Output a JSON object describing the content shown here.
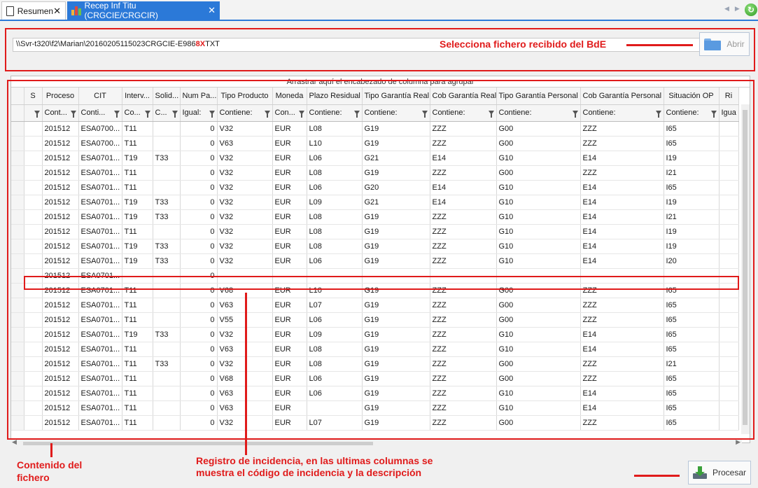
{
  "tabs": [
    {
      "label": "Resumen",
      "close": "✕"
    },
    {
      "label": "Recep Inf Titu (CRGCIE/CRGCIR)",
      "close": "✕"
    }
  ],
  "file": {
    "path_prefix": "\\\\Svr-t320\\f2\\Marian\\20160205115023CRGCIE-E986",
    "path_marked": "8X",
    "path_suffix": "TXT",
    "open_button": "Abrir"
  },
  "annotations": {
    "select_file": "Selecciona fichero recibido del BdE",
    "content": "Contenido del\nfichero",
    "incident": "Registro de incidencia, en las ultimas columnas se\nmuestra el código de incidencia y la descripción"
  },
  "grid": {
    "group_hint": "Arrastrar aquí el encabezado de columna para agrupar",
    "columns": [
      "",
      "S",
      "Proceso",
      "CIT",
      "Interv...",
      "Solid...",
      "Num Pa...",
      "Tipo Producto",
      "Moneda",
      "Plazo Residual",
      "Tipo Garantía Real",
      "Cob Garantía Real",
      "Tipo Garantía Personal",
      "Cob Garantía Personal",
      "Situación OP",
      "Ri"
    ],
    "filters": [
      "",
      "",
      "Cont...",
      "Conti...",
      "Co...",
      "C...",
      "Igual:",
      "Contiene:",
      "Con...",
      "Contiene:",
      "Contiene:",
      "Contiene:",
      "Contiene:",
      "Contiene:",
      "Contiene:",
      "Igua"
    ],
    "rows": [
      [
        "201512",
        "ESA0700...",
        "T11",
        "",
        "0",
        "V32",
        "EUR",
        "L08",
        "G19",
        "ZZZ",
        "G00",
        "ZZZ",
        "I65"
      ],
      [
        "201512",
        "ESA0700...",
        "T11",
        "",
        "0",
        "V63",
        "EUR",
        "L10",
        "G19",
        "ZZZ",
        "G00",
        "ZZZ",
        "I65"
      ],
      [
        "201512",
        "ESA0701...",
        "T19",
        "T33",
        "0",
        "V32",
        "EUR",
        "L06",
        "G21",
        "E14",
        "G10",
        "E14",
        "I19"
      ],
      [
        "201512",
        "ESA0701...",
        "T11",
        "",
        "0",
        "V32",
        "EUR",
        "L08",
        "G19",
        "ZZZ",
        "G00",
        "ZZZ",
        "I21"
      ],
      [
        "201512",
        "ESA0701...",
        "T11",
        "",
        "0",
        "V32",
        "EUR",
        "L06",
        "G20",
        "E14",
        "G10",
        "E14",
        "I65"
      ],
      [
        "201512",
        "ESA0701...",
        "T19",
        "T33",
        "0",
        "V32",
        "EUR",
        "L09",
        "G21",
        "E14",
        "G10",
        "E14",
        "I19"
      ],
      [
        "201512",
        "ESA0701...",
        "T19",
        "T33",
        "0",
        "V32",
        "EUR",
        "L08",
        "G19",
        "ZZZ",
        "G10",
        "E14",
        "I21"
      ],
      [
        "201512",
        "ESA0701...",
        "T11",
        "",
        "0",
        "V32",
        "EUR",
        "L08",
        "G19",
        "ZZZ",
        "G10",
        "E14",
        "I19"
      ],
      [
        "201512",
        "ESA0701...",
        "T19",
        "T33",
        "0",
        "V32",
        "EUR",
        "L08",
        "G19",
        "ZZZ",
        "G10",
        "E14",
        "I19"
      ],
      [
        "201512",
        "ESA0701...",
        "T19",
        "T33",
        "0",
        "V32",
        "EUR",
        "L06",
        "G19",
        "ZZZ",
        "G10",
        "E14",
        "I20"
      ],
      [
        "201512",
        "ESA0701...",
        "",
        "",
        "0",
        "",
        "",
        "",
        "",
        "",
        "",
        "",
        ""
      ],
      [
        "201512",
        "ESA0701...",
        "T11",
        "",
        "0",
        "V68",
        "EUR",
        "L10",
        "G19",
        "ZZZ",
        "G00",
        "ZZZ",
        "I65"
      ],
      [
        "201512",
        "ESA0701...",
        "T11",
        "",
        "0",
        "V63",
        "EUR",
        "L07",
        "G19",
        "ZZZ",
        "G00",
        "ZZZ",
        "I65"
      ],
      [
        "201512",
        "ESA0701...",
        "T11",
        "",
        "0",
        "V55",
        "EUR",
        "L06",
        "G19",
        "ZZZ",
        "G00",
        "ZZZ",
        "I65"
      ],
      [
        "201512",
        "ESA0701...",
        "T19",
        "T33",
        "0",
        "V32",
        "EUR",
        "L09",
        "G19",
        "ZZZ",
        "G10",
        "E14",
        "I65"
      ],
      [
        "201512",
        "ESA0701...",
        "T11",
        "",
        "0",
        "V63",
        "EUR",
        "L08",
        "G19",
        "ZZZ",
        "G10",
        "E14",
        "I65"
      ],
      [
        "201512",
        "ESA0701...",
        "T11",
        "T33",
        "0",
        "V32",
        "EUR",
        "L08",
        "G19",
        "ZZZ",
        "G00",
        "ZZZ",
        "I21"
      ],
      [
        "201512",
        "ESA0701...",
        "T11",
        "",
        "0",
        "V68",
        "EUR",
        "L06",
        "G19",
        "ZZZ",
        "G00",
        "ZZZ",
        "I65"
      ],
      [
        "201512",
        "ESA0701...",
        "T11",
        "",
        "0",
        "V63",
        "EUR",
        "L06",
        "G19",
        "ZZZ",
        "G10",
        "E14",
        "I65"
      ],
      [
        "201512",
        "ESA0701...",
        "T11",
        "",
        "0",
        "V63",
        "EUR",
        "",
        "G19",
        "ZZZ",
        "G10",
        "E14",
        "I65"
      ],
      [
        "201512",
        "ESA0701...",
        "T11",
        "",
        "0",
        "V32",
        "EUR",
        "L07",
        "G19",
        "ZZZ",
        "G00",
        "ZZZ",
        "I65"
      ]
    ]
  },
  "process_button": "Procesar",
  "colors": {
    "accent": "#2b79d8",
    "annotation": "#e01b1b"
  }
}
